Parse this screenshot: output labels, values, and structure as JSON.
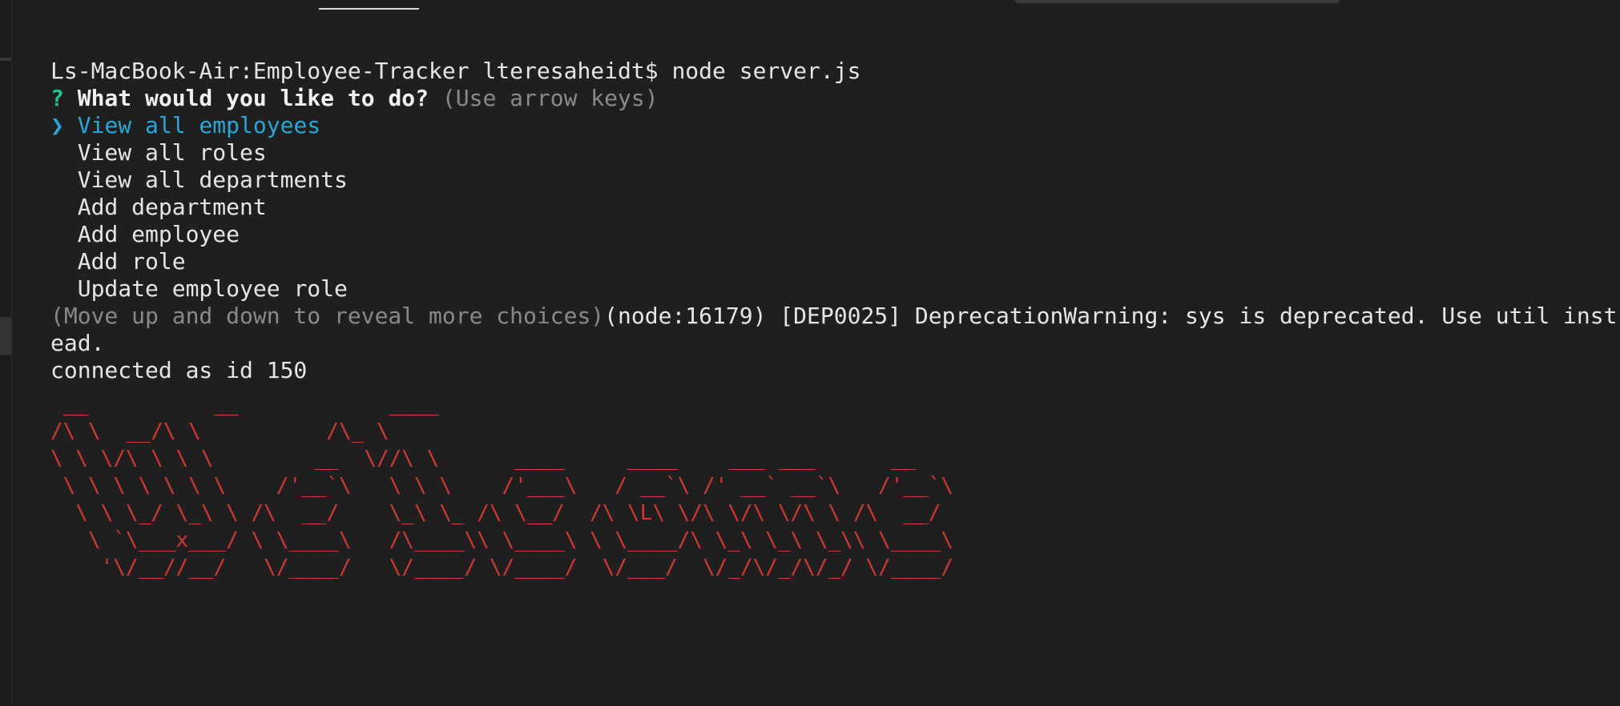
{
  "terminal": {
    "command_line": "Ls-MacBook-Air:Employee-Tracker lteresaheidt$ node server.js",
    "prompt": {
      "marker": "?",
      "question": "What would you like to do?",
      "hint": "(Use arrow keys)"
    },
    "pointer": "❯",
    "choices": [
      "View all employees",
      "View all roles",
      "View all departments",
      "Add department",
      "Add employee",
      "Add role",
      "Update employee role"
    ],
    "more_hint": "(Move up and down to reveal more choices)",
    "warning_1": "(node:16179) [DEP0025] DeprecationWarning: sys is deprecated. Use util inst",
    "warning_2": "ead.",
    "connected": "connected as id 150",
    "ascii_art": " __          __            ____\n/\\ \\  __/\\ \\          /\\_ \\\n\\ \\ \\/\\ \\ \\ \\        __  \\//\\ \\      ____     ____    ___ ___      __\n \\ \\ \\ \\ \\ \\ \\    /'__`\\   \\ \\ \\    /'___\\   / __`\\ /' __` __`\\   /'__`\\\n  \\ \\ \\_/ \\_\\ \\ /\\  __/    \\_\\ \\_ /\\ \\__/  /\\ \\L\\ \\/\\ \\/\\ \\/\\ \\ /\\  __/\n   \\ `\\___x___/ \\ \\____\\   /\\____\\\\ \\____\\ \\ \\____/\\ \\_\\ \\_\\ \\_\\\\ \\____\\\n    '\\/__//__/   \\/____/   \\/____/ \\/____/  \\/___/  \\/_/\\/_/\\/_/ \\/____/"
  },
  "colors": {
    "background": "#1f1f1f",
    "prompt_marker": "#23c48e",
    "selected_choice": "#27a7d8",
    "dim_text": "#8a8a8a",
    "ascii_art": "#d63636"
  }
}
